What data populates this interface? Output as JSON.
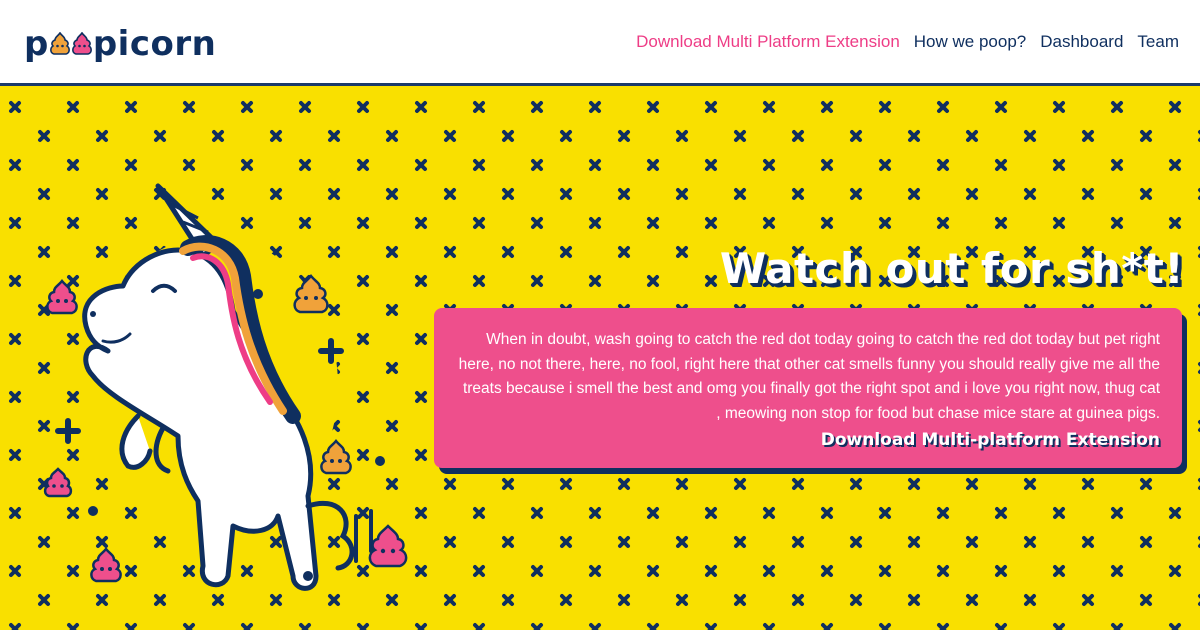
{
  "brand": {
    "logo_prefix": "p",
    "logo_suffix": "picorn",
    "colors": {
      "navy": "#0f2f5f",
      "pink": "#ee3d86",
      "yellow": "#f9e000",
      "card_pink": "#ee4f8c",
      "white": "#ffffff"
    }
  },
  "nav": {
    "items": [
      {
        "label": "Download Multi Platform Extension",
        "accent": true
      },
      {
        "label": "How we poop?",
        "accent": false
      },
      {
        "label": "Dashboard",
        "accent": false
      },
      {
        "label": "Team",
        "accent": false
      }
    ]
  },
  "hero": {
    "headline": "Watch out for sh*t!",
    "body": "When in doubt, wash going to catch the red dot today going to catch the red dot today but pet right here, no not there, here, no fool, right here that other cat smells funny you should really give me all the treats because i smell the best and omg you finally got the right spot and i love you right now, thug cat , meowing non stop for food but chase mice stare at guinea pigs.",
    "cta_label": "Download Multi-platform Extension",
    "illustration": "unicorn-icon",
    "decorations": [
      "poop-emoji-icon",
      "cross-pattern",
      "plus-icon",
      "dot-icon"
    ]
  }
}
